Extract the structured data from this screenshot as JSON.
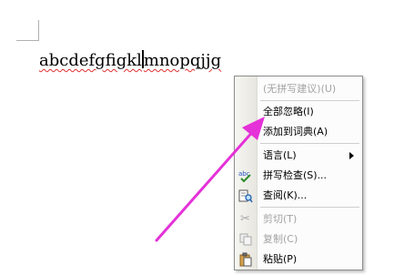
{
  "document": {
    "text_before_caret": "abcdefgfigkl",
    "text_after_caret": "mnopqjjg"
  },
  "context_menu": {
    "items": [
      {
        "label": "(无拼写建议)(U)",
        "disabled": true,
        "icon": ""
      },
      {
        "label": "全部忽略(I)",
        "disabled": false,
        "icon": ""
      },
      {
        "label": "添加到词典(A)",
        "disabled": false,
        "icon": ""
      },
      {
        "label": "语言(L)",
        "disabled": false,
        "icon": "",
        "submenu": true
      },
      {
        "label": "拼写检查(S)...",
        "disabled": false,
        "icon": "spell-check-icon"
      },
      {
        "label": "查阅(K)...",
        "disabled": false,
        "icon": "research-icon"
      },
      {
        "label": "剪切(T)",
        "disabled": true,
        "icon": "scissors-icon"
      },
      {
        "label": "复制(C)",
        "disabled": true,
        "icon": "copy-icon"
      },
      {
        "label": "粘贴(P)",
        "disabled": false,
        "icon": "paste-icon"
      }
    ]
  },
  "colors": {
    "annotation_arrow": "#e531d8",
    "misspelling_underline": "#e03030"
  }
}
